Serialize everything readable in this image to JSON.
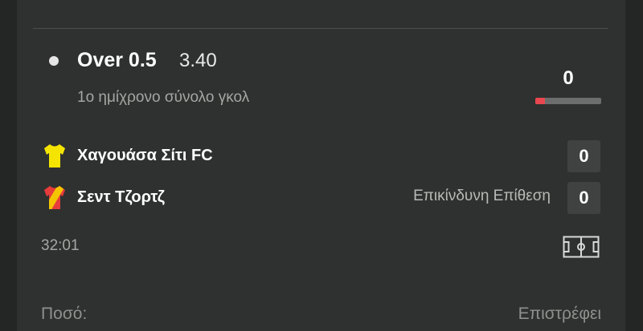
{
  "selection": {
    "name": "Over 0.5",
    "odds": "3.40",
    "market": "1ο ημίχρονο σύνολο γκολ",
    "count": "0",
    "progress_fraction": 0.15,
    "progress_color": "#e8474f"
  },
  "match": {
    "home": {
      "name": "Χαγουάσα Σίτι FC",
      "score": "0",
      "icon": "yellow-shirt-icon",
      "color": "#f5e400"
    },
    "away": {
      "name": "Σεντ Τζορτζ",
      "score": "0",
      "icon": "red-yellow-shirt-icon",
      "colors": [
        "#e63c3c",
        "#f5c400"
      ],
      "status": "Επικίνδυνη Επίθεση"
    },
    "clock": "32:01",
    "pitch_icon": "pitch-icon"
  },
  "footer": {
    "stake_label": "Ποσό:",
    "returns_label": "Επιστρέφει"
  }
}
